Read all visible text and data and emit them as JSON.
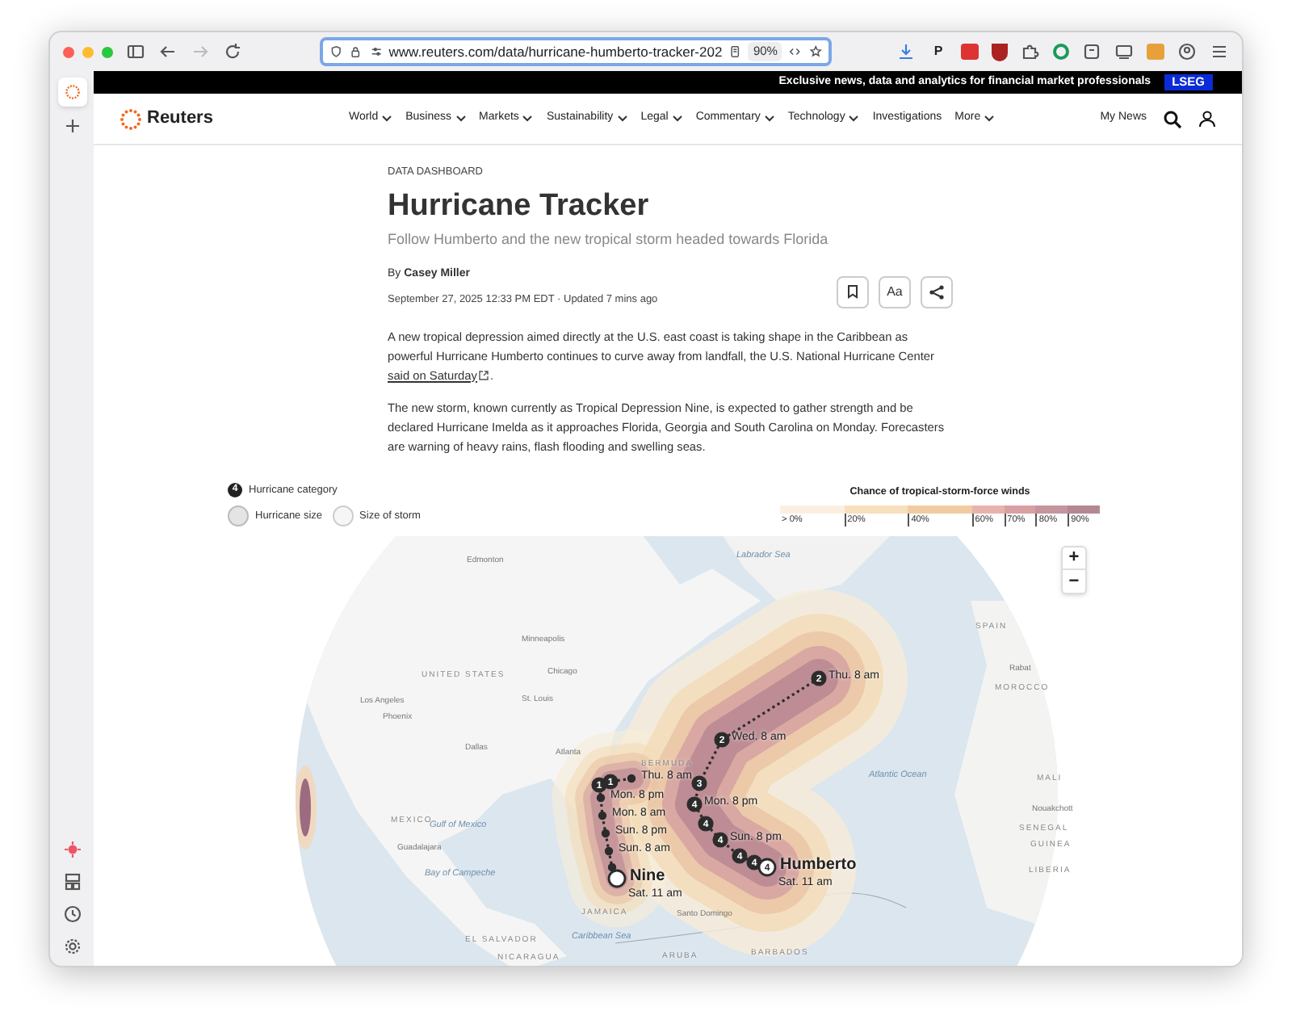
{
  "browser": {
    "url": "www.reuters.com/data/hurricane-humberto-tracker-202",
    "zoom": "90%",
    "extension_letter": "P"
  },
  "top_banner": {
    "text": "Exclusive news, data and analytics for financial market professionals",
    "badge": "LSEG"
  },
  "nav": {
    "logo": "Reuters",
    "items": [
      {
        "label": "World",
        "has_menu": true
      },
      {
        "label": "Business",
        "has_menu": true
      },
      {
        "label": "Markets",
        "has_menu": true
      },
      {
        "label": "Sustainability",
        "has_menu": true
      },
      {
        "label": "Legal",
        "has_menu": true
      },
      {
        "label": "Commentary",
        "has_menu": true
      },
      {
        "label": "Technology",
        "has_menu": true
      },
      {
        "label": "Investigations",
        "has_menu": false
      },
      {
        "label": "More",
        "has_menu": true
      }
    ],
    "my_news": "My News"
  },
  "article": {
    "kicker": "DATA DASHBOARD",
    "title": "Hurricane Tracker",
    "subtitle": "Follow Humberto and the new tropical storm headed towards Florida",
    "byline_prefix": "By",
    "author": "Casey Miller",
    "date": "September 27, 2025 12:33 PM EDT · Updated 7 mins ago",
    "font_button": "Aa",
    "paragraphs": [
      {
        "text": "A new tropical depression aimed directly at the U.S. east coast is taking shape in the Caribbean as powerful Hurricane Humberto continues to curve away from landfall, the U.S. National Hurricane Center",
        "link": "said on Saturday",
        "after": "."
      },
      {
        "text": "The new storm, known currently as Tropical Depression Nine, is expected to gather strength and be declared Hurricane Imelda as it approaches Florida, Georgia and South Carolina on Monday. Forecasters are warning of heavy rains, flash flooding and swelling seas."
      }
    ]
  },
  "legend": {
    "category_badge": "4",
    "category_label": "Hurricane category",
    "size_label": "Hurricane size",
    "storm_size_label": "Size of storm"
  },
  "wind_scale": {
    "title": "Chance of tropical-storm-force winds",
    "steps": [
      {
        "label": "> 0%",
        "color": "#fbf0e0"
      },
      {
        "label": "20%",
        "color": "#f8dfbd"
      },
      {
        "label": "40%",
        "color": "#f3cba3"
      },
      {
        "label": "60%",
        "color": "#e9b3ad"
      },
      {
        "label": "70%",
        "color": "#d9a0a4"
      },
      {
        "label": "80%",
        "color": "#c6949d"
      },
      {
        "label": "90%",
        "color": "#b48893"
      }
    ]
  },
  "map": {
    "places": [
      {
        "name": "Edmonton",
        "kind": "city"
      },
      {
        "name": "Labrador Sea",
        "kind": "water"
      },
      {
        "name": "Minneapolis",
        "kind": "city"
      },
      {
        "name": "UNITED STATES",
        "kind": "country"
      },
      {
        "name": "Chicago",
        "kind": "city"
      },
      {
        "name": "Los Angeles",
        "kind": "city"
      },
      {
        "name": "Phoenix",
        "kind": "city"
      },
      {
        "name": "St. Louis",
        "kind": "city"
      },
      {
        "name": "Dallas",
        "kind": "city"
      },
      {
        "name": "Atlanta",
        "kind": "city"
      },
      {
        "name": "MEXICO",
        "kind": "country"
      },
      {
        "name": "Gulf of Mexico",
        "kind": "water"
      },
      {
        "name": "Guadalajara",
        "kind": "city"
      },
      {
        "name": "Bay of Campeche",
        "kind": "water"
      },
      {
        "name": "JAMAICA",
        "kind": "country"
      },
      {
        "name": "Santo Domingo",
        "kind": "city"
      },
      {
        "name": "EL SALVADOR",
        "kind": "country"
      },
      {
        "name": "Caribbean Sea",
        "kind": "water"
      },
      {
        "name": "NICARAGUA",
        "kind": "country"
      },
      {
        "name": "ARUBA",
        "kind": "country"
      },
      {
        "name": "BARBADOS",
        "kind": "country"
      },
      {
        "name": "BERMUDA",
        "kind": "country"
      },
      {
        "name": "Atlantic Ocean",
        "kind": "water"
      },
      {
        "name": "SPAIN",
        "kind": "country"
      },
      {
        "name": "Rabat",
        "kind": "city"
      },
      {
        "name": "MOROCCO",
        "kind": "country"
      },
      {
        "name": "MALI",
        "kind": "country"
      },
      {
        "name": "Nouakchott",
        "kind": "city"
      },
      {
        "name": "SENEGAL",
        "kind": "country"
      },
      {
        "name": "GUINEA",
        "kind": "country"
      },
      {
        "name": "LIBERIA",
        "kind": "country"
      }
    ],
    "storms": [
      {
        "name": "Humberto",
        "time": "Sat. 11 am",
        "markers": [
          {
            "kind": "badge",
            "category": "2",
            "label": "Thu. 8 am"
          },
          {
            "kind": "badge",
            "category": "2",
            "label": "Wed. 8 am"
          },
          {
            "kind": "badge",
            "category": "3"
          },
          {
            "kind": "badge",
            "category": "4",
            "label": "Mon. 8 pm"
          },
          {
            "kind": "badge",
            "category": "4"
          },
          {
            "kind": "badge",
            "category": "4",
            "label": "Sun. 8 pm"
          },
          {
            "kind": "badge",
            "category": "4"
          },
          {
            "kind": "badge",
            "category": "4"
          },
          {
            "kind": "current",
            "category": "4"
          }
        ]
      },
      {
        "name": "Nine",
        "time": "Sat. 11 am",
        "markers": [
          {
            "kind": "dot",
            "label": "Thu. 8 am"
          },
          {
            "kind": "badge",
            "category": "1"
          },
          {
            "kind": "badge",
            "category": "1"
          },
          {
            "kind": "dot",
            "label": "Mon. 8 pm"
          },
          {
            "kind": "dot",
            "label": "Mon. 8 am"
          },
          {
            "kind": "dot",
            "label": "Sun. 8 pm"
          },
          {
            "kind": "dot",
            "label": "Sun. 8 am"
          },
          {
            "kind": "dot"
          },
          {
            "kind": "current"
          }
        ]
      }
    ],
    "zoom_in": "+",
    "zoom_out": "−"
  }
}
